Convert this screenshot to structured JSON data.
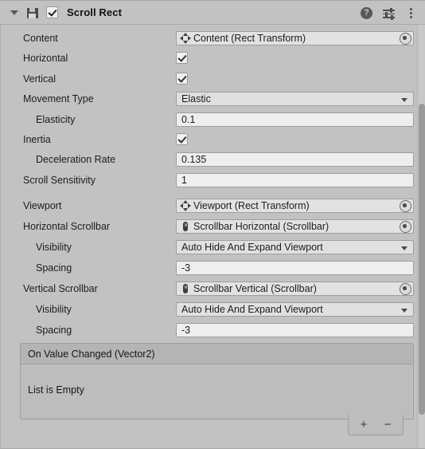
{
  "header": {
    "foldout_icon": "triangle-down-icon",
    "component_icon": "scroll-rect-component-icon",
    "enabled": true,
    "title": "Scroll Rect",
    "help_icon": "help-icon",
    "help_glyph": "?",
    "preset_icon": "preset-settings-icon",
    "menu_icon": "kebab-menu-icon"
  },
  "fields": {
    "content": {
      "label": "Content",
      "value": "Content (Rect Transform)",
      "icon": "rect-transform-icon"
    },
    "horizontal": {
      "label": "Horizontal",
      "checked": true
    },
    "vertical": {
      "label": "Vertical",
      "checked": true
    },
    "movement_type": {
      "label": "Movement Type",
      "value": "Elastic"
    },
    "elasticity": {
      "label": "Elasticity",
      "value": "0.1"
    },
    "inertia": {
      "label": "Inertia",
      "checked": true
    },
    "deceleration_rate": {
      "label": "Deceleration Rate",
      "value": "0.135"
    },
    "scroll_sensitivity": {
      "label": "Scroll Sensitivity",
      "value": "1"
    },
    "viewport": {
      "label": "Viewport",
      "value": "Viewport (Rect Transform)",
      "icon": "rect-transform-icon"
    },
    "horizontal_scrollbar": {
      "label": "Horizontal Scrollbar",
      "value": "Scrollbar Horizontal (Scrollbar)",
      "icon": "scrollbar-icon"
    },
    "horizontal_visibility": {
      "label": "Visibility",
      "value": "Auto Hide And Expand Viewport"
    },
    "horizontal_spacing": {
      "label": "Spacing",
      "value": "-3"
    },
    "vertical_scrollbar": {
      "label": "Vertical Scrollbar",
      "value": "Scrollbar Vertical (Scrollbar)",
      "icon": "scrollbar-icon"
    },
    "vertical_visibility": {
      "label": "Visibility",
      "value": "Auto Hide And Expand Viewport"
    },
    "vertical_spacing": {
      "label": "Spacing",
      "value": "-3"
    }
  },
  "event_list": {
    "title": "On Value Changed (Vector2)",
    "empty_text": "List is Empty",
    "add_label": "+",
    "remove_label": "−"
  },
  "colors": {
    "panel_bg": "#c2c2c2",
    "field_bg": "#eeeeee",
    "object_field_bg": "#e2e2e2",
    "dropdown_bg": "#e0e0e0",
    "border": "#9e9e9e",
    "text": "#1c1c1c",
    "event_header_bg": "#b4b4b4",
    "event_body_bg": "#bdbdbd",
    "scroll_thumb": "#9a9a9a"
  }
}
